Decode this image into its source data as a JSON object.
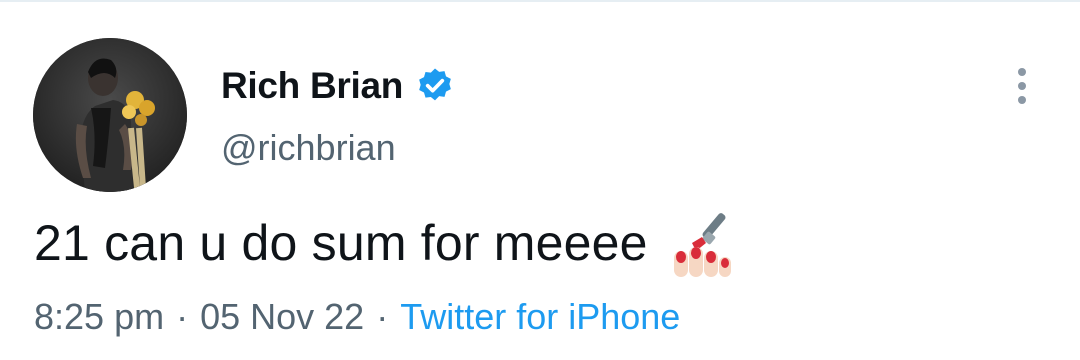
{
  "author": {
    "display_name": "Rich Brian",
    "handle": "@richbrian",
    "verified": true
  },
  "tweet": {
    "text": "21 can u do sum for meeee",
    "emoji": "nail-polish"
  },
  "meta": {
    "time": "8:25 pm",
    "date": "05 Nov 22",
    "separator": "·",
    "source": "Twitter for iPhone"
  },
  "colors": {
    "text": "#0f1419",
    "secondary": "#536471",
    "accent": "#1d9bf0"
  }
}
